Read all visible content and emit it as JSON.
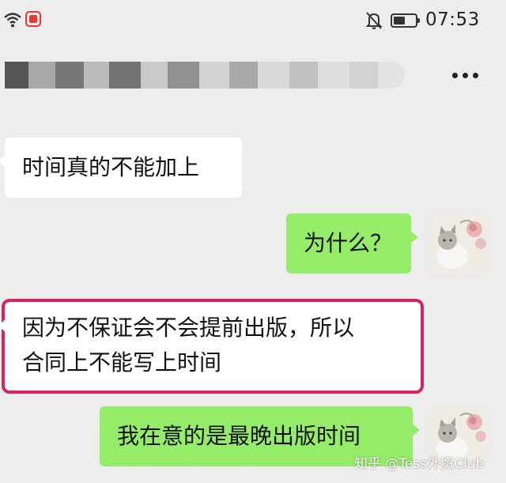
{
  "status_bar": {
    "time": "07:53",
    "battery_level": 0.55,
    "icons": [
      "wifi-icon",
      "app-notification-icon",
      "mute-icon",
      "battery-icon"
    ]
  },
  "header": {
    "title": "",
    "more_icon": "more-icon"
  },
  "messages": [
    {
      "side": "incoming",
      "lines": [
        "时间真的不能加上"
      ]
    },
    {
      "side": "outgoing",
      "lines": [
        "为什么？"
      ]
    },
    {
      "side": "incoming",
      "lines": [
        "因为不保证会不会提前出版，所以",
        "合同上不能写上时间"
      ],
      "highlighted": true
    },
    {
      "side": "outgoing",
      "lines": [
        "我在意的是最晚出版时间"
      ]
    }
  ],
  "watermark": "知乎 @Tess外贸Club",
  "colors": {
    "background": "#ededed",
    "incoming_bubble": "#ffffff",
    "outgoing_bubble": "#95ec69",
    "highlight_border": "#d6245f"
  }
}
